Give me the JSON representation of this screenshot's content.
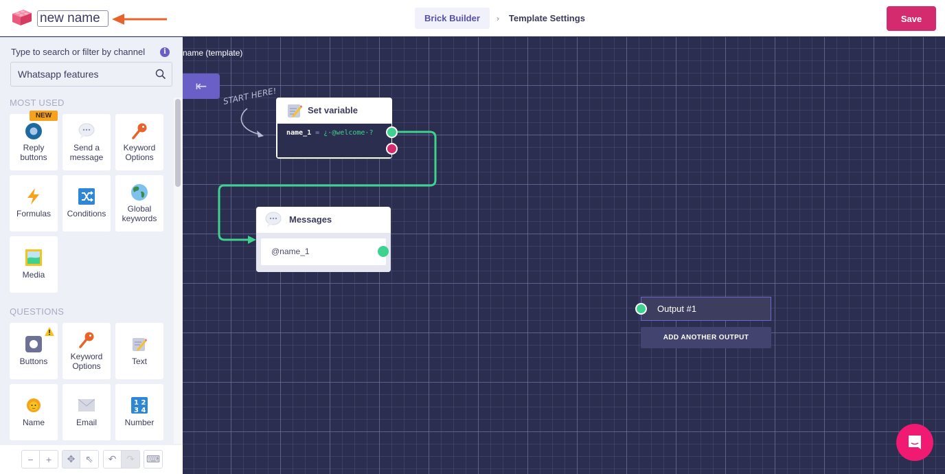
{
  "header": {
    "name_value": "new name",
    "breadcrumbs": [
      "Brick Builder",
      "Template Settings"
    ],
    "breadcrumb_separator": "›",
    "save_label": "Save"
  },
  "colors": {
    "accent": "#6a5fc6",
    "save": "#d42a6e",
    "canvas_bg": "#2c2e50",
    "port_green": "#3fd18f",
    "port_red": "#d42a6e",
    "chat": "#f01a72",
    "annotation_arrow": "#e8632a"
  },
  "sidebar": {
    "search_label": "Type to search or filter by channel",
    "search_value": "Whatsapp features",
    "sections": [
      {
        "title": "MOST USED",
        "items": [
          {
            "label": "Reply buttons",
            "icon": "radio-button-icon",
            "badge": "NEW"
          },
          {
            "label": "Send a message",
            "icon": "speech-bubble-icon"
          },
          {
            "label": "Keyword Options",
            "icon": "key-icon"
          },
          {
            "label": "Formulas",
            "icon": "lightning-icon"
          },
          {
            "label": "Conditions",
            "icon": "shuffle-icon"
          },
          {
            "label": "Global keywords",
            "icon": "globe-icon"
          },
          {
            "label": "Media",
            "icon": "image-icon"
          }
        ]
      },
      {
        "title": "QUESTIONS",
        "items": [
          {
            "label": "Buttons",
            "icon": "button-icon",
            "warning": true
          },
          {
            "label": "Keyword Options",
            "icon": "key-icon"
          },
          {
            "label": "Text",
            "icon": "pencil-memo-icon"
          },
          {
            "label": "Name",
            "icon": "person-icon"
          },
          {
            "label": "Email",
            "icon": "envelope-icon"
          },
          {
            "label": "Number",
            "icon": "numbers-icon"
          }
        ]
      }
    ],
    "toolbar": [
      "zoom-out",
      "zoom-in",
      "pan",
      "select",
      "undo",
      "redo",
      "keyboard"
    ]
  },
  "canvas": {
    "template_title": "name (template)",
    "start_here": "START HERE!",
    "nodes": {
      "set_variable": {
        "title": "Set variable",
        "var_name": "name_1",
        "operator": "=",
        "value": "¿·@welcome·?"
      },
      "messages": {
        "title": "Messages",
        "message": "@name_1"
      }
    },
    "output": {
      "label": "Output #1",
      "add_label": "ADD ANOTHER OUTPUT"
    }
  }
}
